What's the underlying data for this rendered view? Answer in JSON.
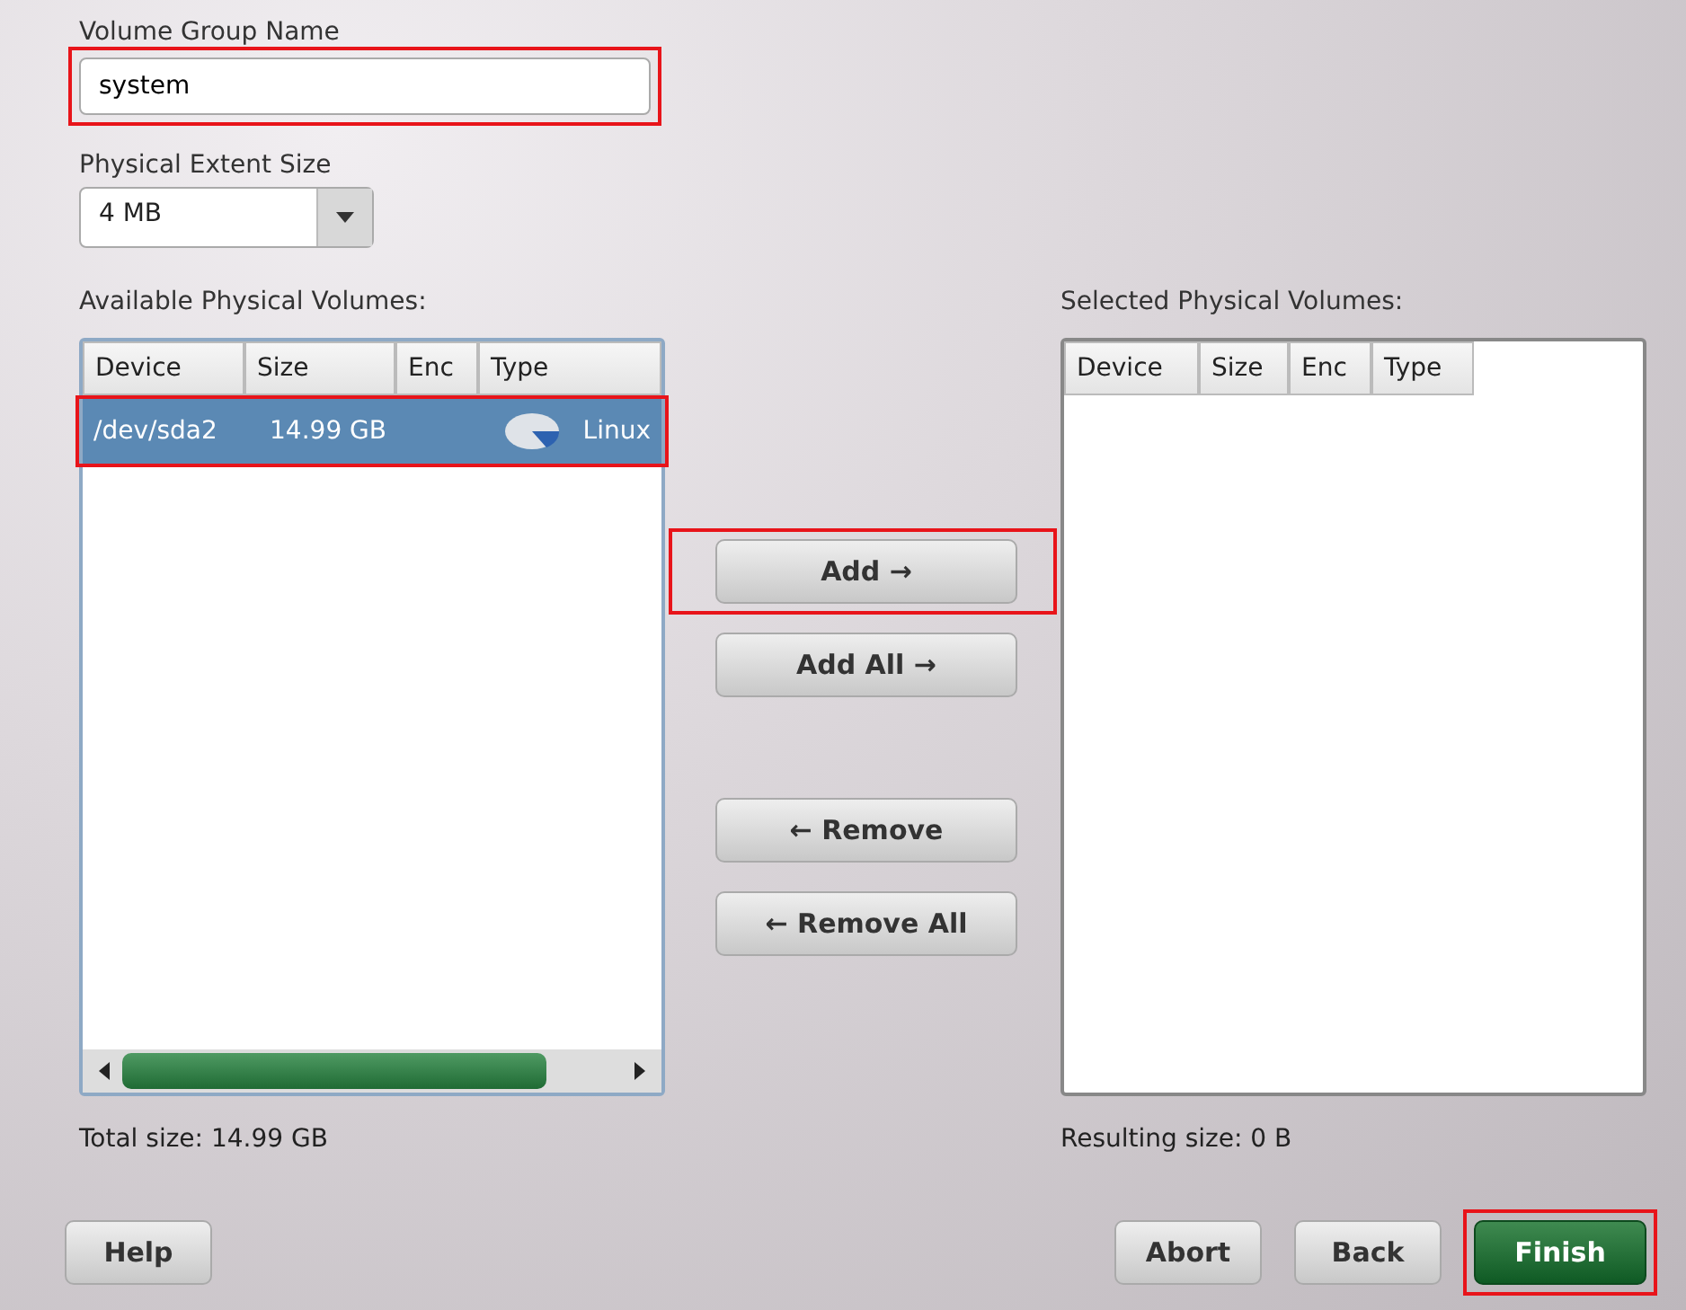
{
  "volume_group_name": {
    "label": "Volume Group Name",
    "value": "system",
    "highlighted": true
  },
  "physical_extent_size": {
    "label": "Physical Extent Size",
    "value": "4 MB"
  },
  "available": {
    "label": "Available Physical Volumes:",
    "columns": [
      "Device",
      "Size",
      "Enc",
      "Type"
    ],
    "rows": [
      {
        "device": "/dev/sda2",
        "size": "14.99 GB",
        "type": "Linux",
        "selected": true,
        "highlighted": true
      }
    ],
    "total": "Total size: 14.99 GB"
  },
  "transfer_buttons": [
    {
      "label": "Add →",
      "highlighted": true
    },
    {
      "label": "Add All →",
      "highlighted": false
    },
    {
      "label": "← Remove",
      "highlighted": false
    },
    {
      "label": "← Remove All",
      "highlighted": false
    }
  ],
  "selected": {
    "label": "Selected Physical Volumes:",
    "columns": [
      "Device",
      "Size",
      "Enc",
      "Type"
    ],
    "total": "Resulting size: 0 B"
  },
  "buttons": [
    {
      "label": "Help",
      "kind": "plain",
      "highlighted": false
    },
    {
      "label": "Abort",
      "kind": "plain",
      "highlighted": false
    },
    {
      "label": "Back",
      "kind": "plain",
      "highlighted": false
    },
    {
      "label": "Finish",
      "kind": "primary",
      "highlighted": true
    }
  ]
}
